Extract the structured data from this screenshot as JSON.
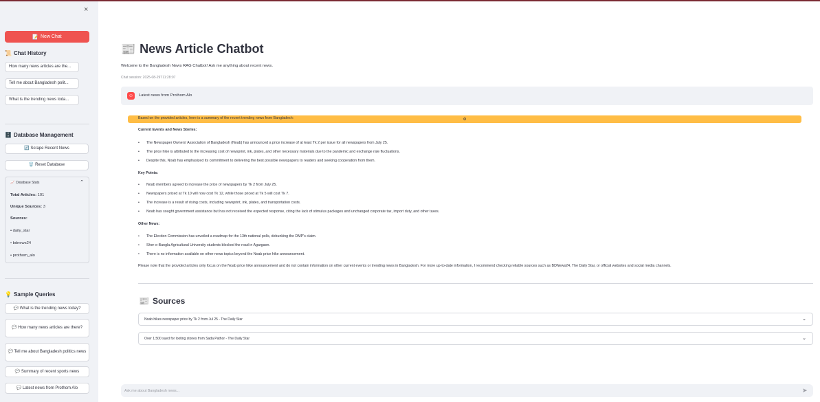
{
  "sidebar": {
    "close_icon": "×",
    "new_chat": {
      "icon": "📝",
      "label": "New Chat"
    },
    "chat_history": {
      "icon": "📜",
      "title": "Chat History",
      "items": [
        "How many news articles are the...",
        "Tell me about Bangladesh polit...",
        "What is the trending news toda..."
      ]
    },
    "database": {
      "icon": "🗄️",
      "title": "Database Management",
      "scrape": {
        "icon": "🔄",
        "label": "Scrape Recent News"
      },
      "reset": {
        "icon": "🗑️",
        "label": "Reset Database"
      },
      "stats": {
        "icon": "📈",
        "title": "Database Stats",
        "chevron": "⌃",
        "total_label": "Total Articles:",
        "total_value": "101",
        "unique_label": "Unique Sources:",
        "unique_value": "3",
        "sources_label": "Sources:",
        "sources": [
          "daily_star",
          "bdnews24",
          "prothom_alo"
        ]
      }
    },
    "samples": {
      "icon": "💡",
      "title": "Sample Queries",
      "queries": [
        "💬 What is the trending news today?",
        "💬 How many news articles are there?",
        "💬 Tell me about Bangladesh politics news",
        "💬 Summary of recent sports news",
        "💬 Latest news from Prothom Alo"
      ]
    }
  },
  "main": {
    "title_icon": "📰",
    "title": "News Article Chatbot",
    "welcome": "Welcome to the Bangladesh News RAG Chatbot! Ask me anything about recent news.",
    "session": "Chat session: 2025-08-29T11:28:07",
    "user_message": "Latest news from Prothom Alo",
    "assistant": {
      "intro": "Based on the provided articles, here is a summary of the recent trending news from Bangladesh:",
      "sections": [
        {
          "heading": "Current Events and News Stories:",
          "bullets": [
            "The Newspaper Owners' Association of Bangladesh (Noab) has announced a price increase of at least Tk 2 per issue for all newspapers from July 25.",
            "The price hike is attributed to the increasing cost of newsprint, ink, plates, and other necessary materials due to the pandemic and exchange rate fluctuations.",
            "Despite this, Noab has emphasized its commitment to delivering the best possible newspapers to readers and seeking cooperation from them."
          ]
        },
        {
          "heading": "Key Points:",
          "bullets": [
            "Noab members agreed to increase the price of newspapers by Tk 2 from July 25.",
            "Newspapers priced at Tk 10 will now cost Tk 12, while those priced at Tk 5 will cost Tk 7.",
            "The increase is a result of rising costs, including newsprint, ink, plates, and transportation costs.",
            "Noab has sought government assistance but has not received the expected response, citing the lack of stimulus packages and unchanged corporate tax, import duty, and other taxes."
          ]
        },
        {
          "heading": "Other News:",
          "bullets": [
            "The Election Commission has unveiled a roadmap for the 13th national polls, debunking the DMP's claim.",
            "Sher-e-Bangla Agricultural University students blocked the road in Agargaon.",
            "There is no information available on other news topics beyond the Noab price hike announcement."
          ]
        }
      ],
      "note": "Please note that the provided articles only focus on the Noab price hike announcement and do not contain information on other current events or trending news in Bangladesh. For more up-to-date information, I recommend checking reliable sources such as BDNews24, The Daily Star, or official websites and social media channels."
    },
    "sources": {
      "icon": "📰",
      "title": "Sources",
      "items": [
        "Noab hikes newspaper price by Tk 2 from Jul 25 - The Daily Star",
        "Over 1,500 sued for looting stones from Sada Pathor - The Daily Star"
      ],
      "chevron": "⌄"
    },
    "input": {
      "placeholder": "Ask me about Bangladesh news...",
      "send_icon": "➤"
    }
  }
}
